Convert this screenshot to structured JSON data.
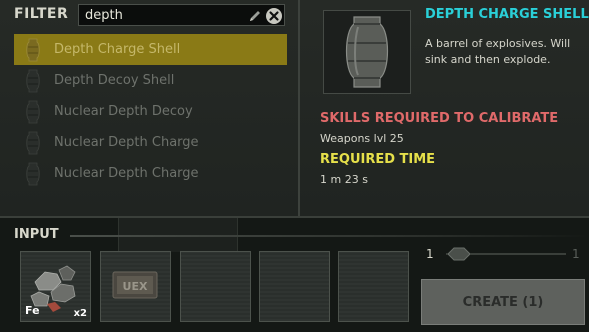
{
  "filter": {
    "label": "FILTER",
    "value": "depth"
  },
  "items": [
    {
      "label": "Depth Charge Shell",
      "selected": true
    },
    {
      "label": "Depth Decoy Shell",
      "selected": false
    },
    {
      "label": "Nuclear Depth Decoy",
      "selected": false
    },
    {
      "label": "Nuclear Depth Charge",
      "selected": false
    },
    {
      "label": "Nuclear Depth Charge",
      "selected": false
    }
  ],
  "detail": {
    "title": "DEPTH CHARGE SHELL",
    "description": "A barrel of explosives. Will sink and then explode.",
    "skills_heading": "SKILLS REQUIRED TO CALIBRATE",
    "skills_value": "Weapons lvl 25",
    "time_heading": "REQUIRED TIME",
    "time_value": "1 m 23 s"
  },
  "input": {
    "label": "INPUT",
    "slots": [
      {
        "icon": "iron-ore-icon",
        "badge": "Fe",
        "count": "x2"
      },
      {
        "icon": "uex-explosive-icon",
        "badge": "UEX",
        "count": ""
      },
      {
        "icon": "",
        "badge": "",
        "count": ""
      },
      {
        "icon": "",
        "badge": "",
        "count": ""
      },
      {
        "icon": "",
        "badge": "",
        "count": ""
      }
    ]
  },
  "quantity": {
    "min": "1",
    "max": "1",
    "current": 1
  },
  "create_button": "CREATE (1)",
  "colors": {
    "selected_row": "#8a7a16",
    "title_cyan": "#2ad0d8",
    "skills_red": "#e06a6a",
    "time_yellow": "#e6e04a"
  }
}
